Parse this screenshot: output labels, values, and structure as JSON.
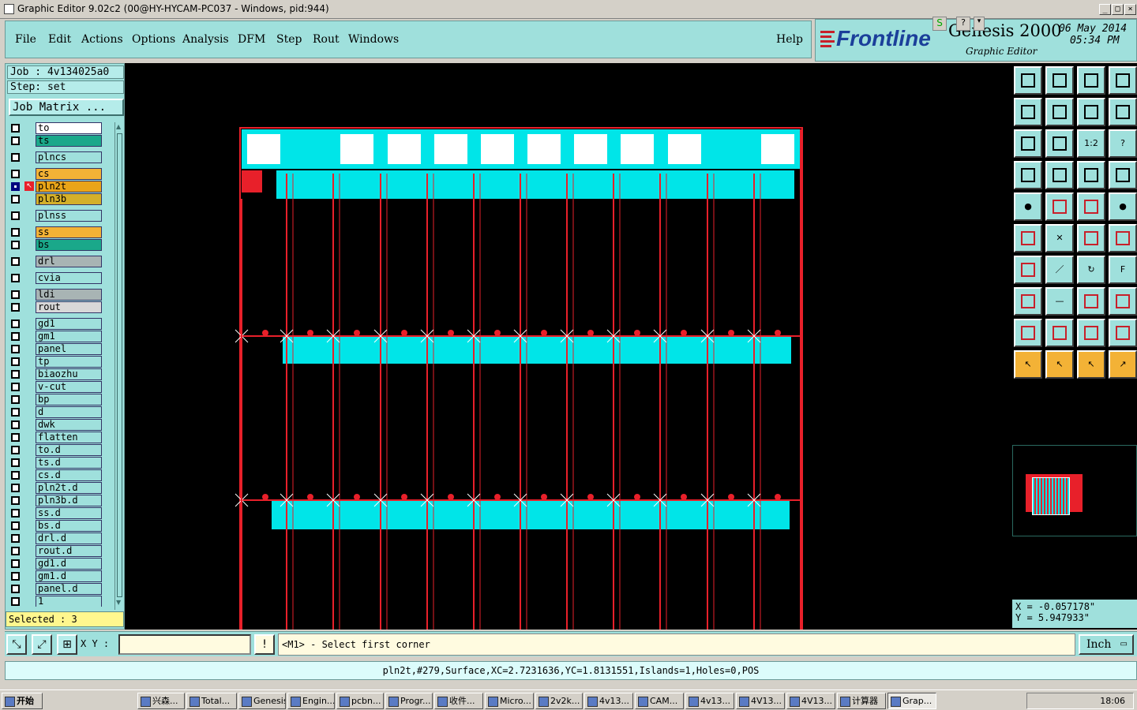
{
  "window": {
    "title": "Graphic Editor 9.02c2 (00@HY-HYCAM-PC037 - Windows, pid:944)",
    "controls": [
      "_",
      "□",
      "×"
    ]
  },
  "menu": {
    "items": [
      "File",
      "Edit",
      "Actions",
      "Options",
      "Analysis",
      "DFM",
      "Step",
      "Rout",
      "Windows"
    ],
    "help": "Help"
  },
  "brand": {
    "logo": "Frontline",
    "product": "Genesis 2000",
    "subtitle": "Graphic Editor",
    "date": "06 May 2014",
    "time": "05:34 PM"
  },
  "job": {
    "job_label": "Job : 4v134025a0",
    "step_label": "Step: set",
    "matrix_button": "Job Matrix ..."
  },
  "layers": [
    {
      "name": "to",
      "color": "#ffffff"
    },
    {
      "name": "ts",
      "color": "#1aa88a"
    },
    {
      "name": "plncs",
      "color": "#9fe0dc"
    },
    {
      "name": "cs",
      "color": "#f3b236"
    },
    {
      "name": "pln2t",
      "color": "#e9a418",
      "active": true
    },
    {
      "name": "pln3b",
      "color": "#d4b02a"
    },
    {
      "name": "plnss",
      "color": "#9fe0dc"
    },
    {
      "name": "ss",
      "color": "#f3b236"
    },
    {
      "name": "bs",
      "color": "#1aa88a"
    },
    {
      "name": "drl",
      "color": "#a8b4b4"
    },
    {
      "name": "cvia",
      "color": "#9fe0dc"
    },
    {
      "name": "ldi",
      "color": "#a8b4b4"
    },
    {
      "name": "rout",
      "color": "#d8d8d8"
    },
    {
      "name": "gd1",
      "color": "#9fe0dc"
    },
    {
      "name": "gm1",
      "color": "#9fe0dc"
    },
    {
      "name": "panel",
      "color": "#9fe0dc"
    },
    {
      "name": "tp",
      "color": "#9fe0dc"
    },
    {
      "name": "biaozhu",
      "color": "#9fe0dc"
    },
    {
      "name": "v-cut",
      "color": "#9fe0dc"
    },
    {
      "name": "bp",
      "color": "#9fe0dc"
    },
    {
      "name": "d",
      "color": "#9fe0dc"
    },
    {
      "name": "dwk",
      "color": "#9fe0dc"
    },
    {
      "name": "flatten",
      "color": "#9fe0dc"
    },
    {
      "name": "to.d",
      "color": "#9fe0dc"
    },
    {
      "name": "ts.d",
      "color": "#9fe0dc"
    },
    {
      "name": "cs.d",
      "color": "#9fe0dc"
    },
    {
      "name": "pln2t.d",
      "color": "#9fe0dc"
    },
    {
      "name": "pln3b.d",
      "color": "#9fe0dc"
    },
    {
      "name": "ss.d",
      "color": "#9fe0dc"
    },
    {
      "name": "bs.d",
      "color": "#9fe0dc"
    },
    {
      "name": "drl.d",
      "color": "#9fe0dc"
    },
    {
      "name": "rout.d",
      "color": "#9fe0dc"
    },
    {
      "name": "gd1.d",
      "color": "#9fe0dc"
    },
    {
      "name": "gm1.d",
      "color": "#9fe0dc"
    },
    {
      "name": "panel.d",
      "color": "#9fe0dc"
    },
    {
      "name": "1",
      "color": "#9fe0dc"
    }
  ],
  "selection": {
    "text": "Selected : 3"
  },
  "coords": {
    "x": "X = -0.057178\"",
    "y": "Y = 5.947933\""
  },
  "command": {
    "xy_label": "X Y :",
    "xy_value": "",
    "prompt": "<M1> - Select first corner",
    "unit": "Inch"
  },
  "status": {
    "text": "pln2t,#279,Surface,XC=2.7231636,YC=1.8131551,Islands=1,Holes=0,POS"
  },
  "taskbar": {
    "start": "开始",
    "tasks": [
      "兴森...",
      "Total...",
      "Genesis",
      "Engin...",
      "pcbn...",
      "Progr...",
      "收件...",
      "Micro...",
      "2v2k...",
      "4v13...",
      "CAM...",
      "4v13...",
      "4V13...",
      "4V13...",
      "计算器",
      "Grap..."
    ],
    "active_task": "Grap...",
    "clock": "18:06"
  },
  "tools": {
    "grid": [
      [
        "home-out",
        "home-in",
        "home",
        "window"
      ],
      [
        "pan-left",
        "pan-right",
        "swap",
        "s-shape"
      ],
      [
        "fit",
        "center",
        "1:2",
        "help"
      ],
      [
        "measure-tool",
        "probe",
        "layer-select",
        "layer-select-2"
      ],
      [
        "pad",
        "polygon",
        "ruler",
        "dot"
      ],
      [
        "node-edit",
        "cross",
        "line-draw",
        "line-draw-2"
      ],
      [
        "angle",
        "slash",
        "arc",
        "ff"
      ],
      [
        "pad-add",
        "dash",
        "stretch",
        "shapes"
      ],
      [
        "triangle-red",
        "triangle-up",
        "triangle-blue",
        "triangle-line"
      ],
      [
        "pointer",
        "pointer-box",
        "pointer-circle",
        "pointer-route"
      ]
    ],
    "selected_row": 9,
    "icon_glyphs": {
      "help": "?",
      "1:2": "1:2",
      "pointer": "↖",
      "pointer-box": "↖",
      "pointer-circle": "↖",
      "pointer-route": "↗",
      "cross": "✕",
      "slash": "／",
      "arc": "↻",
      "dash": "—",
      "ff": "F",
      "dot": "●",
      "pad": "●"
    }
  },
  "colors": {
    "panel": "#9fe0dc",
    "canvas": "#000000",
    "copper": "#00e5e8",
    "outline": "#e8202a",
    "highlight": "#f3b236"
  }
}
